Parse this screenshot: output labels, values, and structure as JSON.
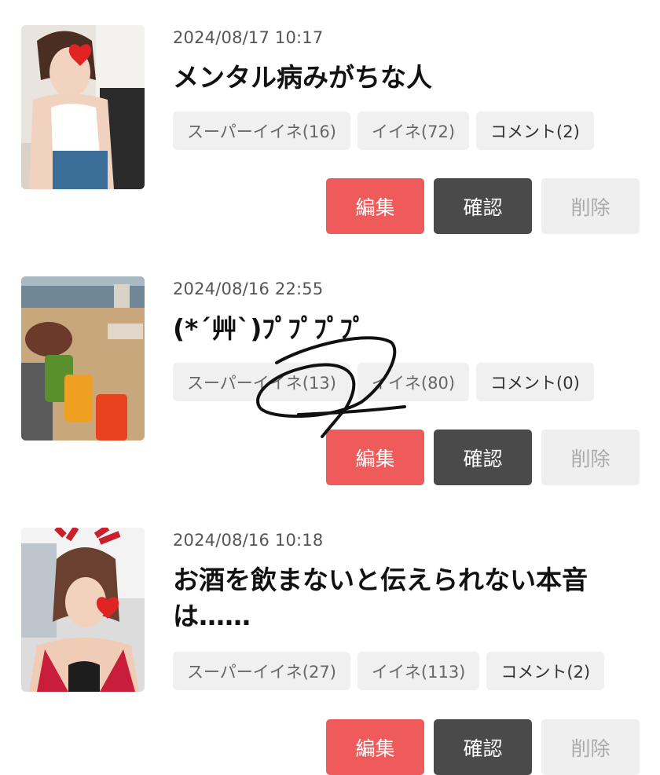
{
  "posts": [
    {
      "date": "2024/08/17 10:17",
      "title": "メンタル病みがちな人",
      "stats": {
        "super_like": "スーパーイイネ(16)",
        "like": "イイネ(72)",
        "comment": "コメント(2)"
      },
      "actions": {
        "edit": "編集",
        "confirm": "確認",
        "delete": "削除"
      }
    },
    {
      "date": "2024/08/16 22:55",
      "title": "(*´艸`)ﾌﾟﾌﾟﾌﾟﾌﾟ",
      "stats": {
        "super_like": "スーパーイイネ(13)",
        "like": "イイネ(80)",
        "comment": "コメント(0)"
      },
      "actions": {
        "edit": "編集",
        "confirm": "確認",
        "delete": "削除"
      }
    },
    {
      "date": "2024/08/16 10:18",
      "title": "お酒を飲まないと伝えられない本音は……",
      "stats": {
        "super_like": "スーパーイイネ(27)",
        "like": "イイネ(113)",
        "comment": "コメント(2)"
      },
      "actions": {
        "edit": "編集",
        "confirm": "確認",
        "delete": "削除"
      }
    }
  ],
  "colors": {
    "edit_button": "#ef5b5b",
    "confirm_button": "#4a4a4a",
    "delete_button": "#efefef",
    "stat_chip": "#f0f0f0"
  }
}
